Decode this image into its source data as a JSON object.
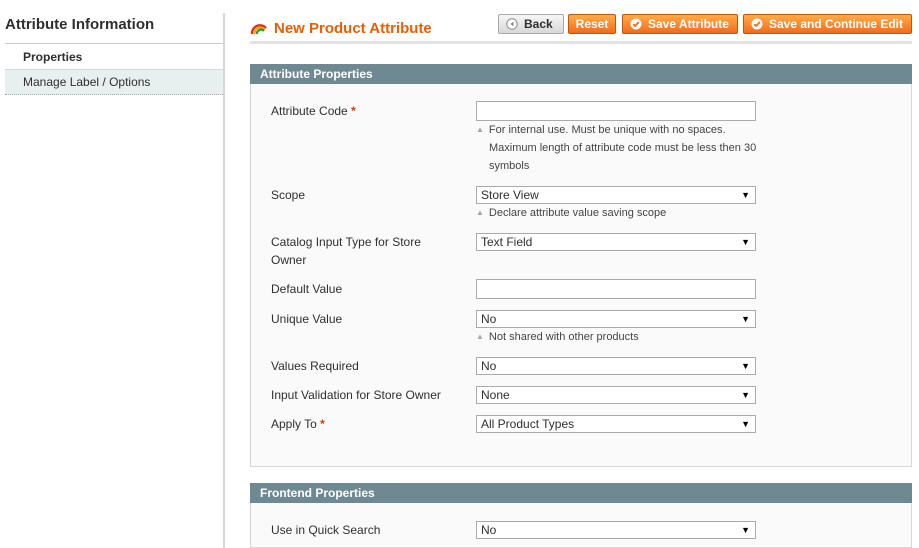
{
  "sidebar": {
    "title": "Attribute Information",
    "tabs": [
      {
        "label": "Properties"
      },
      {
        "label": "Manage Label / Options"
      }
    ]
  },
  "header": {
    "title": "New Product Attribute",
    "buttons": {
      "back": "Back",
      "reset": "Reset",
      "save": "Save Attribute",
      "save_continue": "Save and Continue Edit"
    }
  },
  "attribute_properties": {
    "heading": "Attribute Properties",
    "attribute_code": {
      "label": "Attribute Code",
      "required_mark": "*",
      "value": "",
      "note_line1": "For internal use. Must be unique with no spaces.",
      "note_line2": "Maximum length of attribute code must be less then 30",
      "note_line3": "symbols"
    },
    "scope": {
      "label": "Scope",
      "value": "Store View",
      "note": "Declare attribute value saving scope"
    },
    "input_type": {
      "label_line1": "Catalog Input Type for Store",
      "label_line2": "Owner",
      "value": "Text Field"
    },
    "default_value": {
      "label": "Default Value",
      "value": ""
    },
    "unique_value": {
      "label": "Unique Value",
      "value": "No",
      "note": "Not shared with other products"
    },
    "values_required": {
      "label": "Values Required",
      "value": "No"
    },
    "input_validation": {
      "label": "Input Validation for Store Owner",
      "value": "None"
    },
    "apply_to": {
      "label": "Apply To",
      "required_mark": "*",
      "value": "All Product Types"
    }
  },
  "frontend_properties": {
    "heading": "Frontend Properties",
    "quick_search": {
      "label": "Use in Quick Search",
      "value": "No"
    }
  },
  "colors": {
    "accent": "#eb5e00",
    "section_header": "#6f8992",
    "button_orange": "#f36b1d"
  }
}
